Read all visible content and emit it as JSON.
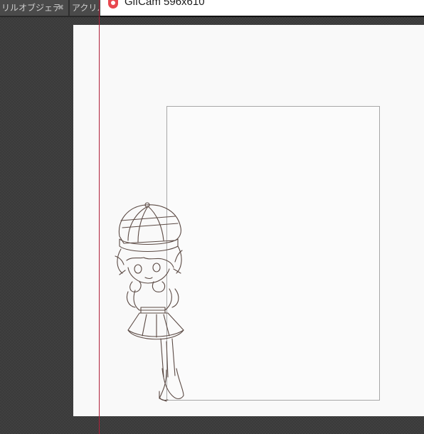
{
  "tabs": [
    {
      "label": "リルオブジェテ",
      "close": "✖"
    },
    {
      "label": "アクリル"
    }
  ],
  "gifcam": {
    "title": "GifCam 596x610"
  },
  "colors": {
    "canvas": "#f9f9f9",
    "panel_border": "#a7a7a7",
    "app_background": "#404040",
    "gifcam_border": "#111111",
    "gifcam_accent": "#e8484f",
    "line_art": "#5b4a44"
  }
}
